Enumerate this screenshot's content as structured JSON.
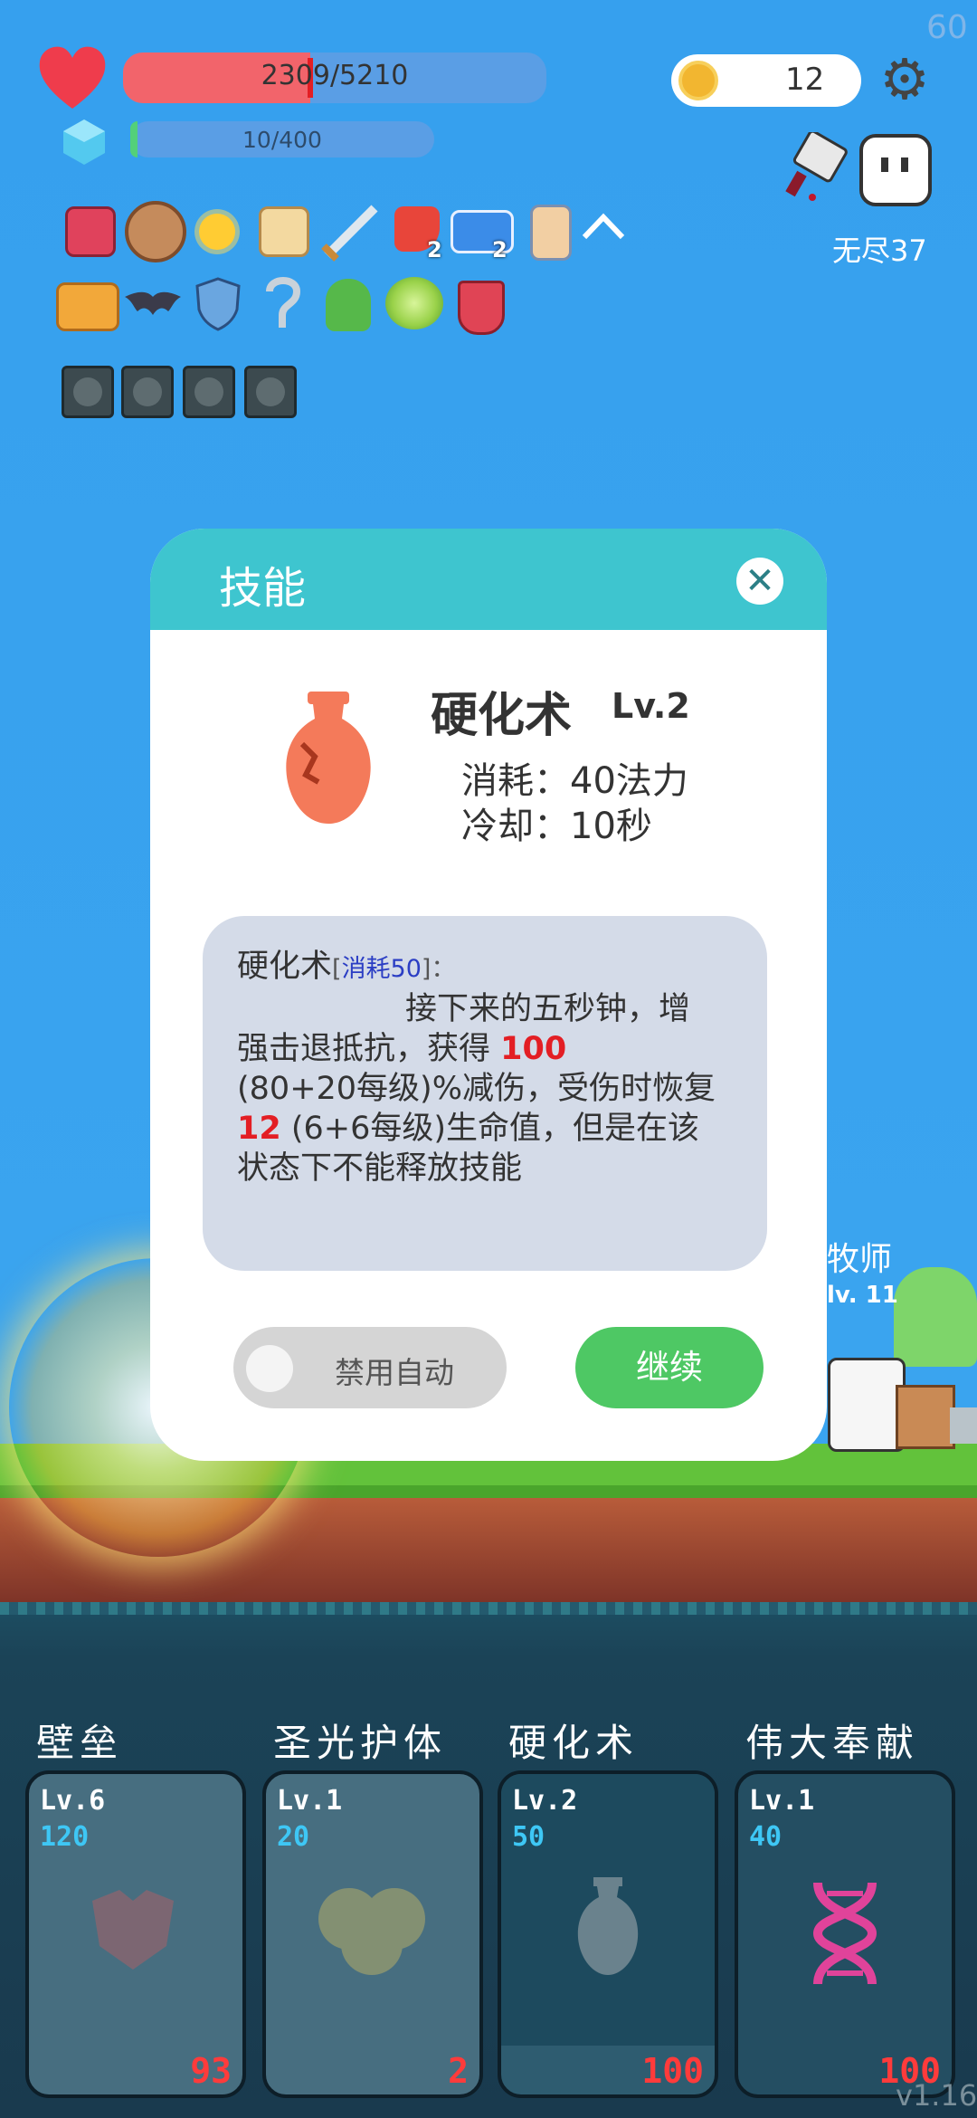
{
  "fps": "60",
  "hud": {
    "hp": {
      "text": "2309/5210",
      "ratio": 0.443
    },
    "mp": {
      "text": "10/400",
      "ratio": 0.025
    },
    "coins": "12",
    "endless_label": "无尽37"
  },
  "icons": {
    "row1": [
      "jam-jar-icon",
      "round-shield-icon",
      "sun-icon",
      "treasure-map-icon",
      "sword-icon",
      "red-sock-icon",
      "star-card-icon",
      "bandaged-hand-icon"
    ],
    "row1_counts": {
      "red-sock-icon": "2",
      "star-card-icon": "2"
    },
    "row2": [
      "menu-book-icon",
      "bat-icon",
      "blue-shield-icon",
      "hook-icon",
      "green-monster-icon",
      "lime-icon",
      "red-badge-icon"
    ]
  },
  "modal": {
    "title": "技能",
    "skill_name": "硬化术",
    "skill_level": "Lv.2",
    "cost_line": "消耗：40法力",
    "cooldown_line": "冷却：10秒",
    "desc": {
      "name": "硬化术",
      "cost_tag_open": "[",
      "cost_tag": "消耗50",
      "cost_tag_close": "]：",
      "line1": "接下来的五秒钟，增",
      "line2a": "强击退抵抗，获得 ",
      "line2b": "100",
      "line3": "(80+20每级)%减伤，受伤时恢复",
      "line4a": "12",
      "line4b": " (6+6每级)生命值，但是在该",
      "line5": "状态下不能释放技能"
    },
    "toggle_label": "禁用自动",
    "continue_label": "继续"
  },
  "npc": {
    "name": "牧师",
    "level": "lv. 11"
  },
  "skills": [
    {
      "title": "壁垒",
      "level": "Lv.6",
      "cost": "120",
      "cooldown": "93"
    },
    {
      "title": "圣光护体",
      "level": "Lv.1",
      "cost": "20",
      "cooldown": "2"
    },
    {
      "title": "硬化术",
      "level": "Lv.2",
      "cost": "50",
      "cooldown": "100"
    },
    {
      "title": "伟大奉献",
      "level": "Lv.1",
      "cost": "40",
      "cooldown": "100"
    }
  ],
  "version": "v1.16",
  "colors": {
    "accent": "#3ec5cf",
    "continue": "#4ec864",
    "hp": "#f2646b",
    "danger": "#e31e24"
  }
}
